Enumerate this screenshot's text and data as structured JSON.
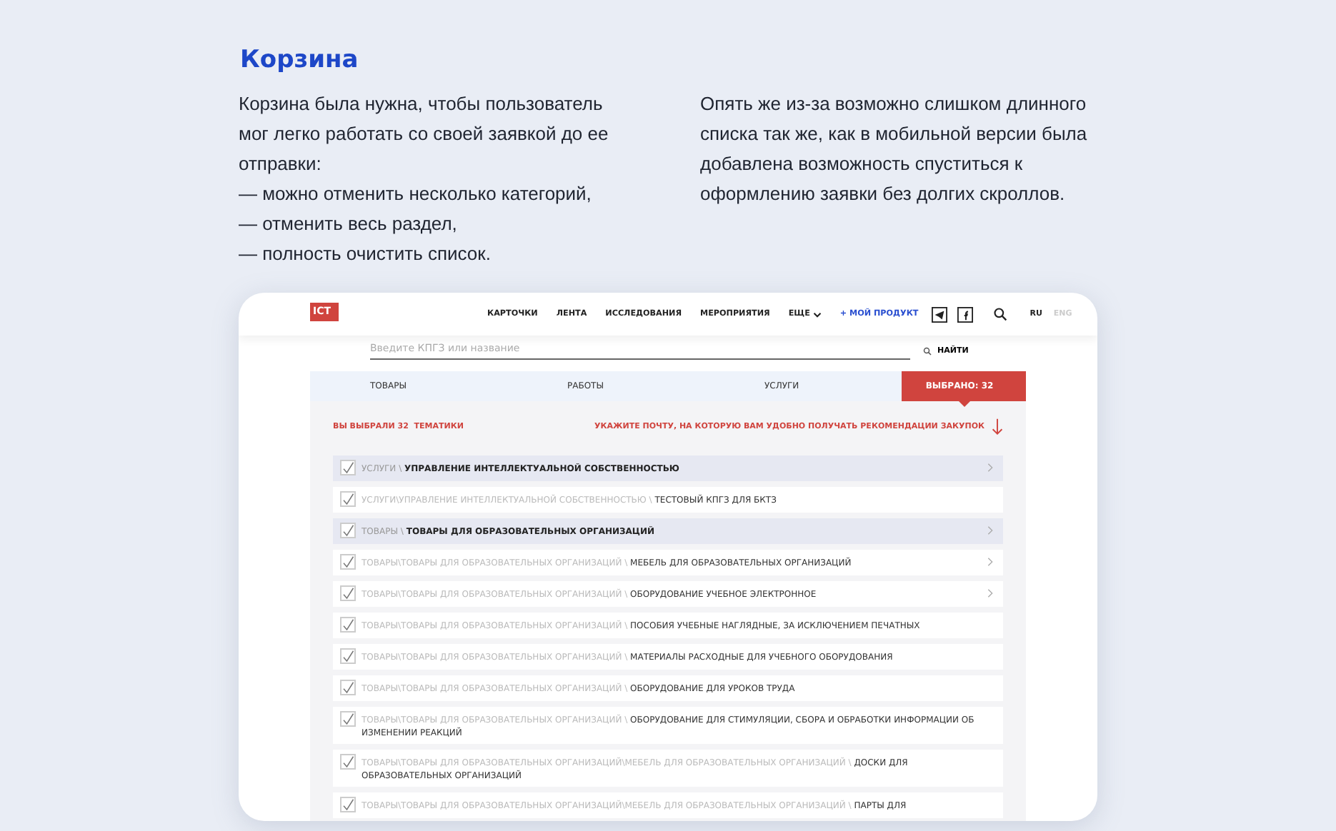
{
  "heading": "Корзина",
  "intro": {
    "text": "Корзина была нужна, чтобы пользователь мог легко работать со своей заявкой до ее отправки:",
    "points": [
      "— можно отменить несколько категорий,",
      "— отменить весь раздел,",
      "— полность очистить список."
    ]
  },
  "note": "Опять же из-за возможно слишком длинного списка так же, как в мобильной версии была добавлена возможность спуститься к оформлению заявки без долгих скроллов.",
  "site": {
    "logo": "ICT",
    "nav": [
      "КАРТОЧКИ",
      "ЛЕНТА",
      "ИССЛЕДОВАНИЯ",
      "МЕРОПРИЯТИЯ",
      "ЕЩЕ"
    ],
    "product_link": "+ МОЙ ПРОДУКТ",
    "languages": [
      {
        "label": "RU",
        "selected": true
      },
      {
        "label": "ENG",
        "selected": false
      }
    ],
    "search": {
      "placeholder": "Введите КПГЗ или название",
      "button": "НАЙТИ"
    },
    "tabs": [
      {
        "label": "ТОВАРЫ",
        "selected": false
      },
      {
        "label": "РАБОТЫ",
        "selected": false
      },
      {
        "label": "УСЛУГИ",
        "selected": false
      },
      {
        "label": "ВЫБРАНО: 32",
        "selected": true
      }
    ],
    "summary": "ВЫ ВЫБРАЛИ 32  ТЕМАТИКИ",
    "email_prompt": "УКАЖИТЕ ПОЧТУ, НА КОТОРУЮ ВАМ УДОБНО ПОЛУЧАТЬ РЕКОМЕНДАЦИИ ЗАКУПОК",
    "rows": [
      {
        "kind": "group",
        "path": "УСЛУГИ \\",
        "name": "УПРАВЛЕНИЕ ИНТЕЛЛЕКТУАЛЬНОЙ СОБСТВЕННОСТЬЮ",
        "checked": true,
        "expandable": true
      },
      {
        "kind": "item",
        "path": "УСЛУГИ\\УПРАВЛЕНИЕ ИНТЕЛЛЕКТУАЛЬНОЙ СОБСТВЕННОСТЬЮ \\",
        "name": "ТЕСТОВЫЙ КПГЗ ДЛЯ БКТЗ",
        "checked": true,
        "expandable": false
      },
      {
        "kind": "group",
        "path": "ТОВАРЫ \\",
        "name": "ТОВАРЫ ДЛЯ ОБРАЗОВАТЕЛЬНЫХ ОРГАНИЗАЦИЙ",
        "checked": true,
        "expandable": true
      },
      {
        "kind": "item",
        "path": "ТОВАРЫ\\ТОВАРЫ ДЛЯ ОБРАЗОВАТЕЛЬНЫХ ОРГАНИЗАЦИЙ \\",
        "name": "МЕБЕЛЬ ДЛЯ ОБРАЗОВАТЕЛЬНЫХ ОРГАНИЗАЦИЙ",
        "checked": true,
        "expandable": true
      },
      {
        "kind": "item",
        "path": "ТОВАРЫ\\ТОВАРЫ ДЛЯ ОБРАЗОВАТЕЛЬНЫХ ОРГАНИЗАЦИЙ \\",
        "name": "ОБОРУДОВАНИЕ УЧЕБНОЕ ЭЛЕКТРОННОЕ",
        "checked": true,
        "expandable": true
      },
      {
        "kind": "item",
        "path": "ТОВАРЫ\\ТОВАРЫ ДЛЯ ОБРАЗОВАТЕЛЬНЫХ ОРГАНИЗАЦИЙ \\",
        "name": "ПОСОБИЯ УЧЕБНЫЕ НАГЛЯДНЫЕ, ЗА ИСКЛЮЧЕНИЕМ ПЕЧАТНЫХ",
        "checked": true,
        "expandable": false
      },
      {
        "kind": "item",
        "path": "ТОВАРЫ\\ТОВАРЫ ДЛЯ ОБРАЗОВАТЕЛЬНЫХ ОРГАНИЗАЦИЙ \\",
        "name": "МАТЕРИАЛЫ РАСХОДНЫЕ ДЛЯ УЧЕБНОГО ОБОРУДОВАНИЯ",
        "checked": true,
        "expandable": false
      },
      {
        "kind": "item",
        "path": "ТОВАРЫ\\ТОВАРЫ ДЛЯ ОБРАЗОВАТЕЛЬНЫХ ОРГАНИЗАЦИЙ \\",
        "name": "ОБОРУДОВАНИЕ ДЛЯ УРОКОВ ТРУДА",
        "checked": true,
        "expandable": false
      },
      {
        "kind": "item",
        "path": "ТОВАРЫ\\ТОВАРЫ ДЛЯ ОБРАЗОВАТЕЛЬНЫХ ОРГАНИЗАЦИЙ \\",
        "name": "ОБОРУДОВАНИЕ ДЛЯ СТИМУЛЯЦИИ, СБОРА И ОБРАБОТКИ ИНФОРМАЦИИ ОБ ИЗМЕНЕНИИ РЕАКЦИЙ",
        "checked": true,
        "expandable": false
      },
      {
        "kind": "item",
        "path": "ТОВАРЫ\\ТОВАРЫ ДЛЯ ОБРАЗОВАТЕЛЬНЫХ ОРГАНИЗАЦИЙ\\МЕБЕЛЬ ДЛЯ ОБРАЗОВАТЕЛЬНЫХ ОРГАНИЗАЦИЙ \\",
        "name": "ДОСКИ ДЛЯ ОБРАЗОВАТЕЛЬНЫХ ОРГАНИЗАЦИЙ",
        "checked": true,
        "expandable": false
      },
      {
        "kind": "item",
        "path": "ТОВАРЫ\\ТОВАРЫ ДЛЯ ОБРАЗОВАТЕЛЬНЫХ ОРГАНИЗАЦИЙ\\МЕБЕЛЬ ДЛЯ ОБРАЗОВАТЕЛЬНЫХ ОРГАНИЗАЦИЙ \\",
        "name": "ПАРТЫ ДЛЯ",
        "checked": true,
        "expandable": false
      }
    ]
  }
}
